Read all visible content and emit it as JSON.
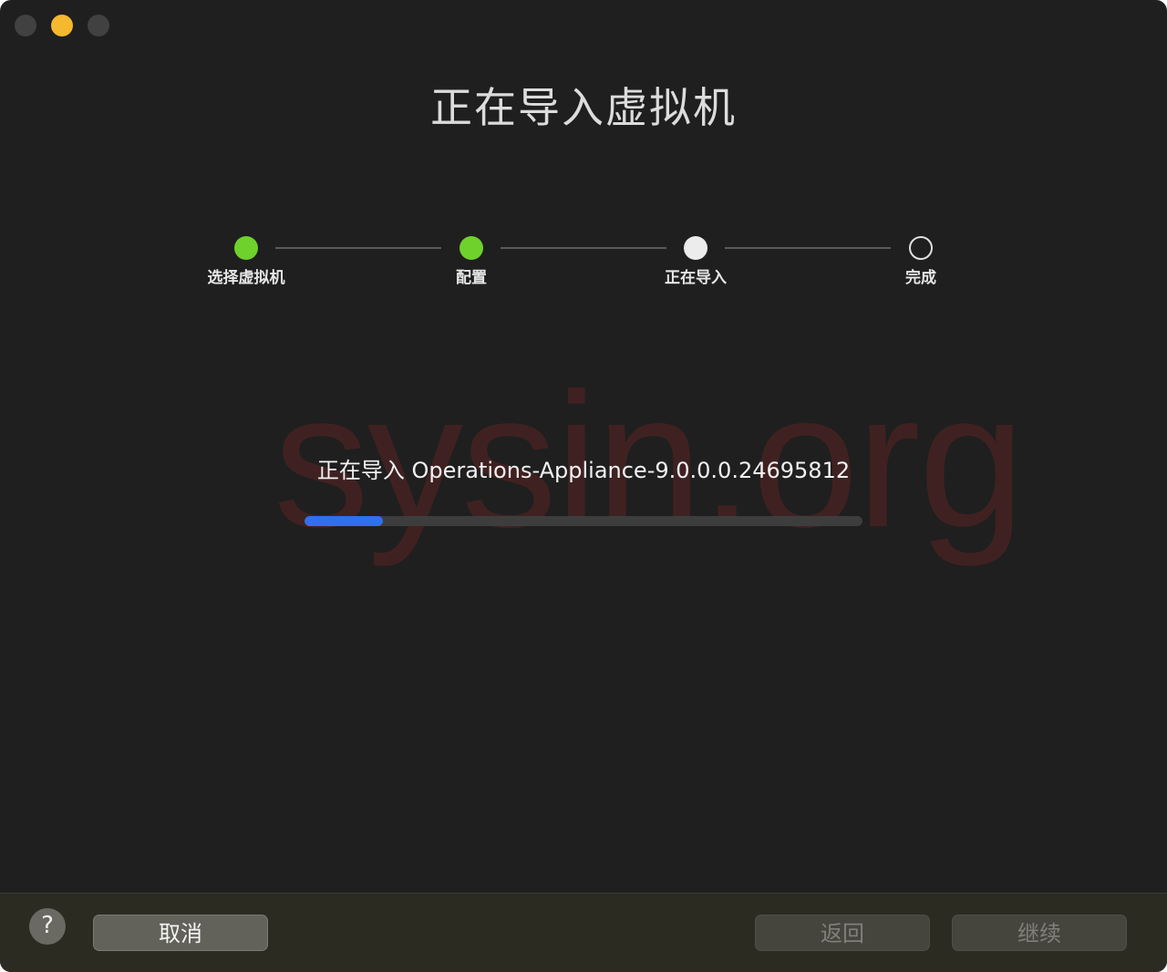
{
  "window": {
    "title": "正在导入虚拟机"
  },
  "stepper": {
    "steps": [
      {
        "label": "选择虚拟机",
        "state": "done"
      },
      {
        "label": "配置",
        "state": "done"
      },
      {
        "label": "正在导入",
        "state": "current"
      },
      {
        "label": "完成",
        "state": "pending"
      }
    ]
  },
  "import": {
    "status_text": "正在导入 Operations-Appliance-9.0.0.0.24695812",
    "progress_fraction": 0.14
  },
  "watermark": "sysin.org",
  "footer": {
    "help_label": "?",
    "cancel_label": "取消",
    "back_label": "返回",
    "continue_label": "继续"
  },
  "colors": {
    "background": "#1f1f1f",
    "step_done": "#6fd12b",
    "step_current": "#ececec",
    "progress": "#2f6ff0",
    "minimize_light": "#f5b82e"
  }
}
